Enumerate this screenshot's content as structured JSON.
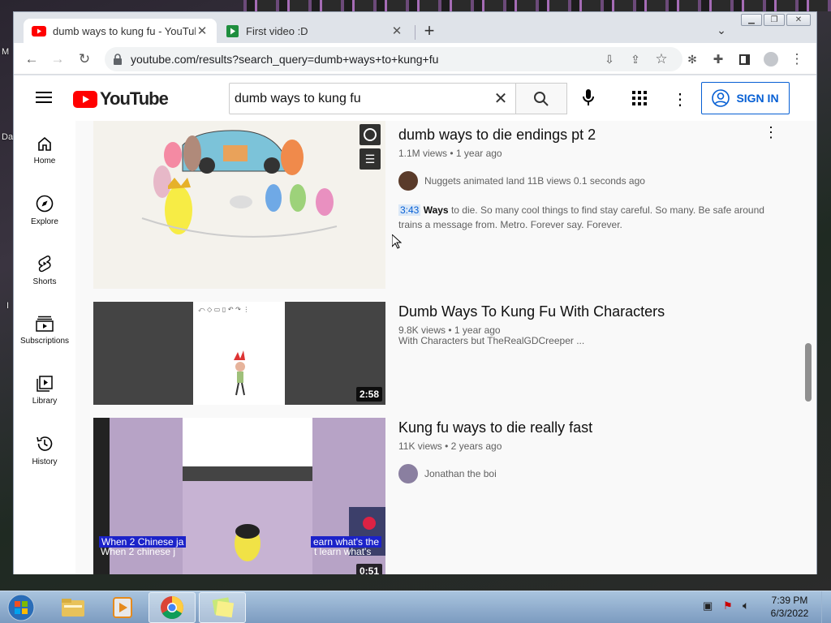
{
  "desktop": {
    "left_label_1": "M",
    "left_label_2": "Da",
    "left_label_3": "I"
  },
  "browser": {
    "tabs": [
      {
        "title": "dumb ways to kung fu - YouTube",
        "favicon": "youtube-icon"
      },
      {
        "title": "First video :D",
        "favicon": "play-green-icon"
      }
    ],
    "new_tab": "+",
    "address": "youtube.com/results?search_query=dumb+ways+to+kung+fu"
  },
  "youtube": {
    "logo_text": "YouTube",
    "search_value": "dumb ways to kung fu",
    "sign_in": "SIGN IN",
    "guide": [
      {
        "label": "Home",
        "icon": "home-icon"
      },
      {
        "label": "Explore",
        "icon": "compass-icon"
      },
      {
        "label": "Shorts",
        "icon": "shorts-icon"
      },
      {
        "label": "Subscriptions",
        "icon": "subscriptions-icon"
      },
      {
        "label": "Library",
        "icon": "library-icon"
      },
      {
        "label": "History",
        "icon": "history-icon"
      }
    ],
    "results": [
      {
        "title": "dumb ways to die endings pt 2",
        "meta": "1.1M views • 1 year ago",
        "channel": "Nuggets animated land 11B views 0.1 seconds ago",
        "snippet_time": "3:43",
        "snippet_bold": "Ways",
        "snippet_rest": " to die. So many cool things to find stay careful. So many. Be safe around trains a message from. Metro. Forever say. Forever."
      },
      {
        "title": "Dumb Ways To Kung Fu With Characters",
        "meta": "9.8K views • 1 year ago",
        "description": "With Characters but TheRealGDCreeper ...",
        "duration": "2:58"
      },
      {
        "title": "Kung fu ways to die really fast",
        "meta": "11K views • 2 years ago",
        "channel": "Jonathan the boi",
        "duration": "0:51",
        "caption_1": "When 2 Chinese ja",
        "caption_2": "earn what's the",
        "caption_3": "When 2 chinese j",
        "caption_4": "t learn what's"
      }
    ]
  },
  "taskbar": {
    "time": "7:39 PM",
    "date": "6/3/2022"
  },
  "colors": {
    "youtube_red": "#ff0000",
    "link_blue": "#065fd4",
    "taskbar": "#8fadd0"
  }
}
